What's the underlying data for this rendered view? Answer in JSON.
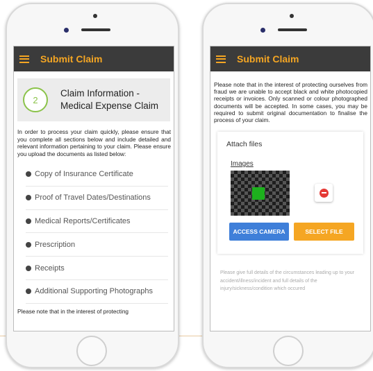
{
  "colors": {
    "accent": "#f5a623",
    "app_bar": "#3b3b3b",
    "camera_button": "#3f7fd9",
    "step_circle": "#8bc34a",
    "remove": "#e53935"
  },
  "left_screen": {
    "app_title": "Submit Claim",
    "step": {
      "number": "2",
      "title_line1": "Claim Information -",
      "title_line2": "Medical Expense Claim"
    },
    "intro": "In order to process your claim quickly, please ensure that you complete all sections below and include detailed and relevant information pertaining to your claim. Please ensure you upload the documents as listed below:",
    "documents": [
      {
        "label": "Copy of Insurance Certificate"
      },
      {
        "label": "Proof of Travel Dates/Destinations"
      },
      {
        "label": "Medical Reports/Certificates"
      },
      {
        "label": "Prescription"
      },
      {
        "label": "Receipts"
      },
      {
        "label": "Additional Supporting Photographs"
      }
    ],
    "cut_off_text": "Please note that in the interest of protecting"
  },
  "right_screen": {
    "app_title": "Submit Claim",
    "notice": "Please note that in the interest of protecting ourselves from fraud we are unable to accept black and white photocopied receipts or invoices. Only scanned or colour photographed documents will be accepted. In some cases, you may be required to submit original documentation to finalise the process of your claim.",
    "attach_title": "Attach files",
    "images_label": "Images",
    "access_camera_label": "ACCESS CAMERA",
    "select_file_label": "SELECT FILE",
    "details_hint": "Please give full details of the circumstances leading up to your accident/illness/incident and full details of the injury/sickness/condition which occured"
  }
}
